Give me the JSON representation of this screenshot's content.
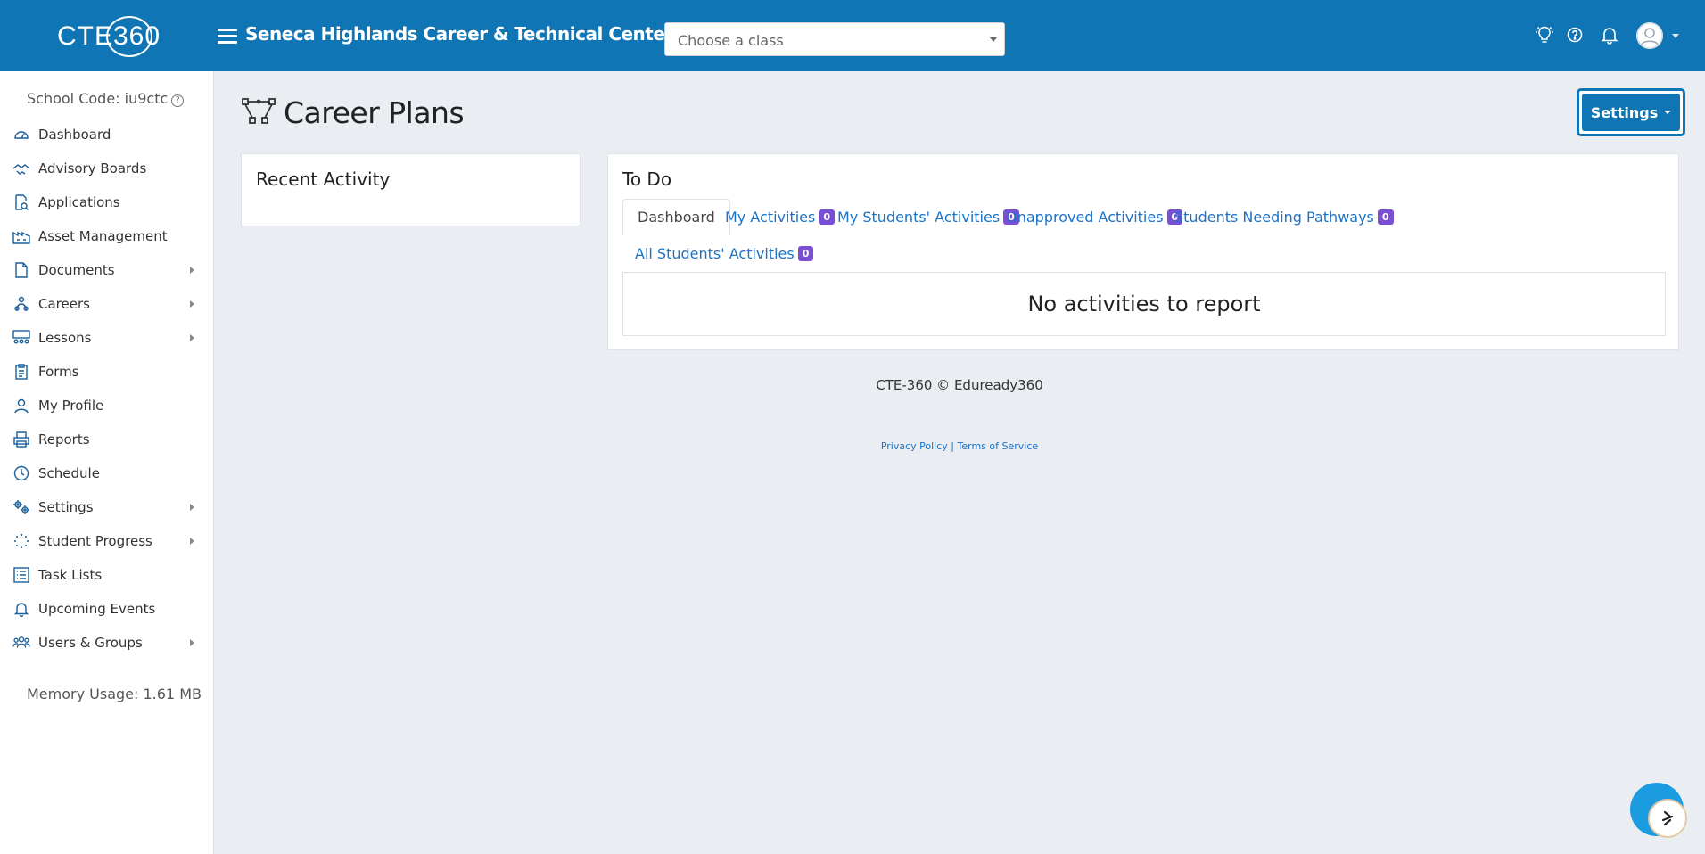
{
  "header": {
    "logo_text": "CTE360",
    "org_title": "Seneca Highlands Career & Technical Center",
    "class_select_placeholder": "Choose a class",
    "icons": [
      "lightbulb-icon",
      "help-icon",
      "bell-icon",
      "user-avatar-icon"
    ]
  },
  "sidebar": {
    "school_code": "School Code: iu9ctc",
    "items": [
      {
        "label": "Dashboard",
        "icon": "dashboard-icon",
        "submenu": false
      },
      {
        "label": "Advisory Boards",
        "icon": "handshake-icon",
        "submenu": false
      },
      {
        "label": "Applications",
        "icon": "file-search-icon",
        "submenu": false
      },
      {
        "label": "Asset Management",
        "icon": "warehouse-icon",
        "submenu": false
      },
      {
        "label": "Documents",
        "icon": "document-icon",
        "submenu": true
      },
      {
        "label": "Careers",
        "icon": "careers-icon",
        "submenu": true
      },
      {
        "label": "Lessons",
        "icon": "lessons-icon",
        "submenu": true
      },
      {
        "label": "Forms",
        "icon": "form-icon",
        "submenu": false
      },
      {
        "label": "My Profile",
        "icon": "profile-icon",
        "submenu": false
      },
      {
        "label": "Reports",
        "icon": "printer-icon",
        "submenu": false
      },
      {
        "label": "Schedule",
        "icon": "clock-icon",
        "submenu": false
      },
      {
        "label": "Settings",
        "icon": "gears-icon",
        "submenu": true
      },
      {
        "label": "Student Progress",
        "icon": "progress-icon",
        "submenu": true
      },
      {
        "label": "Task Lists",
        "icon": "list-icon",
        "submenu": false
      },
      {
        "label": "Upcoming Events",
        "icon": "bell-icon",
        "submenu": false
      },
      {
        "label": "Users & Groups",
        "icon": "users-icon",
        "submenu": true
      }
    ],
    "memory_usage": "Memory Usage: 1.61 MB"
  },
  "main": {
    "page_title": "Career Plans",
    "settings_button": "Settings",
    "recent_activity_title": "Recent Activity",
    "todo": {
      "title": "To Do",
      "tabs": [
        {
          "label": "Dashboard",
          "badge": null,
          "active": true
        },
        {
          "label": "My Activities",
          "badge": "0",
          "active": false
        },
        {
          "label": "My Students' Activities",
          "badge": "0",
          "active": false
        },
        {
          "label": "Unapproved Activities",
          "badge": "0",
          "active": false
        },
        {
          "label": "Students Needing Pathways",
          "badge": "0",
          "active": false
        },
        {
          "label": "All Students' Activities",
          "badge": "0",
          "active": false
        }
      ],
      "empty_message": "No activities to report"
    }
  },
  "footer": {
    "copyright": "CTE-360 © Eduready360",
    "privacy_link": "Privacy Policy",
    "separator": "|",
    "terms_link": "Terms of Service"
  },
  "colors": {
    "brand_blue": "#0f75b4",
    "link_blue": "#1a73c9",
    "badge_purple": "#7b4fd3",
    "page_bg": "#eaedf2"
  }
}
